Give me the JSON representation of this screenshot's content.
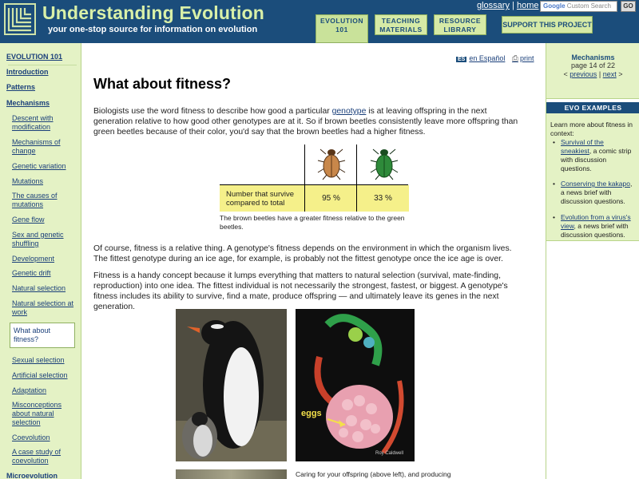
{
  "header": {
    "site_title": "Understanding Evolution",
    "tagline": "your one-stop source for information on evolution",
    "tabs": [
      {
        "line1": "EVOLUTION",
        "line2": "101"
      },
      {
        "line1": "TEACHING",
        "line2": "MATERIALS"
      },
      {
        "line1": "RESOURCE",
        "line2": "LIBRARY"
      }
    ],
    "top_links": {
      "glossary": "glossary",
      "separator1": "|",
      "home": "home",
      "separator2": "|"
    },
    "search": {
      "placeholder_brand": "Google",
      "placeholder_text": "Custom Search"
    },
    "go_label": "GO",
    "support_label": "SUPPORT THIS PROJECT"
  },
  "sidebar": {
    "top_label": "EVOLUTION 101",
    "introduction": "Introduction",
    "patterns": "Patterns",
    "mechanisms": "Mechanisms",
    "items": [
      {
        "label": "Descent with modification"
      },
      {
        "label": "Mechanisms of change"
      },
      {
        "label": "Genetic variation"
      },
      {
        "label": "Mutations"
      },
      {
        "label": "The causes of mutations"
      },
      {
        "label": "Gene flow"
      },
      {
        "label": "Sex and genetic shuffling"
      },
      {
        "label": "Development"
      },
      {
        "label": "Genetic drift"
      },
      {
        "label": "Natural selection"
      },
      {
        "label": "Natural selection at work"
      },
      {
        "label": "What about fitness?"
      },
      {
        "label": "Sexual selection"
      },
      {
        "label": "Artificial selection"
      },
      {
        "label": "Adaptation"
      },
      {
        "label": "Misconceptions about natural selection"
      },
      {
        "label": "Coevolution"
      },
      {
        "label": "A case study of coevolution"
      }
    ],
    "microevolution": "Microevolution"
  },
  "main": {
    "lang_badge": "ES",
    "lang_link": "en Español",
    "print_link": "print",
    "print_icon": "printer-icon",
    "title": "What about fitness?",
    "para1_before": "Biologists use the word fitness to describe how good a particular ",
    "para1_link": "genotype",
    "para1_after": " is at leaving offspring in the next generation relative to how good other genotypes are at it. So if brown beetles consistently leave more offspring than green beetles because of their color, you'd say that the brown beetles had a higher fitness.",
    "table": {
      "row_label": "Number that survive compared to total",
      "brown_value": "95 %",
      "green_value": "33 %"
    },
    "table_caption": "The brown beetles have a greater fitness relative to the green beetles.",
    "para2": "Of course, fitness is a relative thing. A genotype's fitness depends on the environment in which the organism lives. The fittest genotype during an ice age, for example, is probably not the fittest genotype once the ice age is over.",
    "para3": "Fitness is a handy concept because it lumps everything that matters to natural selection (survival, mate-finding, reproduction) into one idea. The fittest individual is not necessarily the strongest, fastest, or biggest. A genotype's fitness includes its ability to survive, find a mate, produce offspring — and ultimately leave its genes in the next generation.",
    "photo_label_eggs": "eggs",
    "photo_credit": "Roy Caldwell",
    "photo_caption": "Caring for your offspring (above left), and producing"
  },
  "right": {
    "pager_title": "Mechanisms",
    "pager_page": "page 14 of 22",
    "prev_label": "previous",
    "next_label": "next",
    "prev_arrow": "<",
    "next_arrow": ">",
    "evo_header": "EVO EXAMPLES",
    "evo_intro": "Learn more about fitness in context:",
    "examples": [
      {
        "link": "Survival of the sneakiest",
        "rest": ", a comic strip with discussion questions."
      },
      {
        "link": "Conserving the kakapo",
        "rest": ", a news brief with discussion questions."
      },
      {
        "link": "Evolution from a virus's view",
        "rest": ", a news brief with discussion questions."
      }
    ]
  },
  "colors": {
    "header_bg": "#1b4d7b",
    "sidebar_bg": "#e4f2c5",
    "title_green": "#d9f0a8",
    "table_yellow": "#f5f08a",
    "link_blue": "#1a3f7a"
  }
}
